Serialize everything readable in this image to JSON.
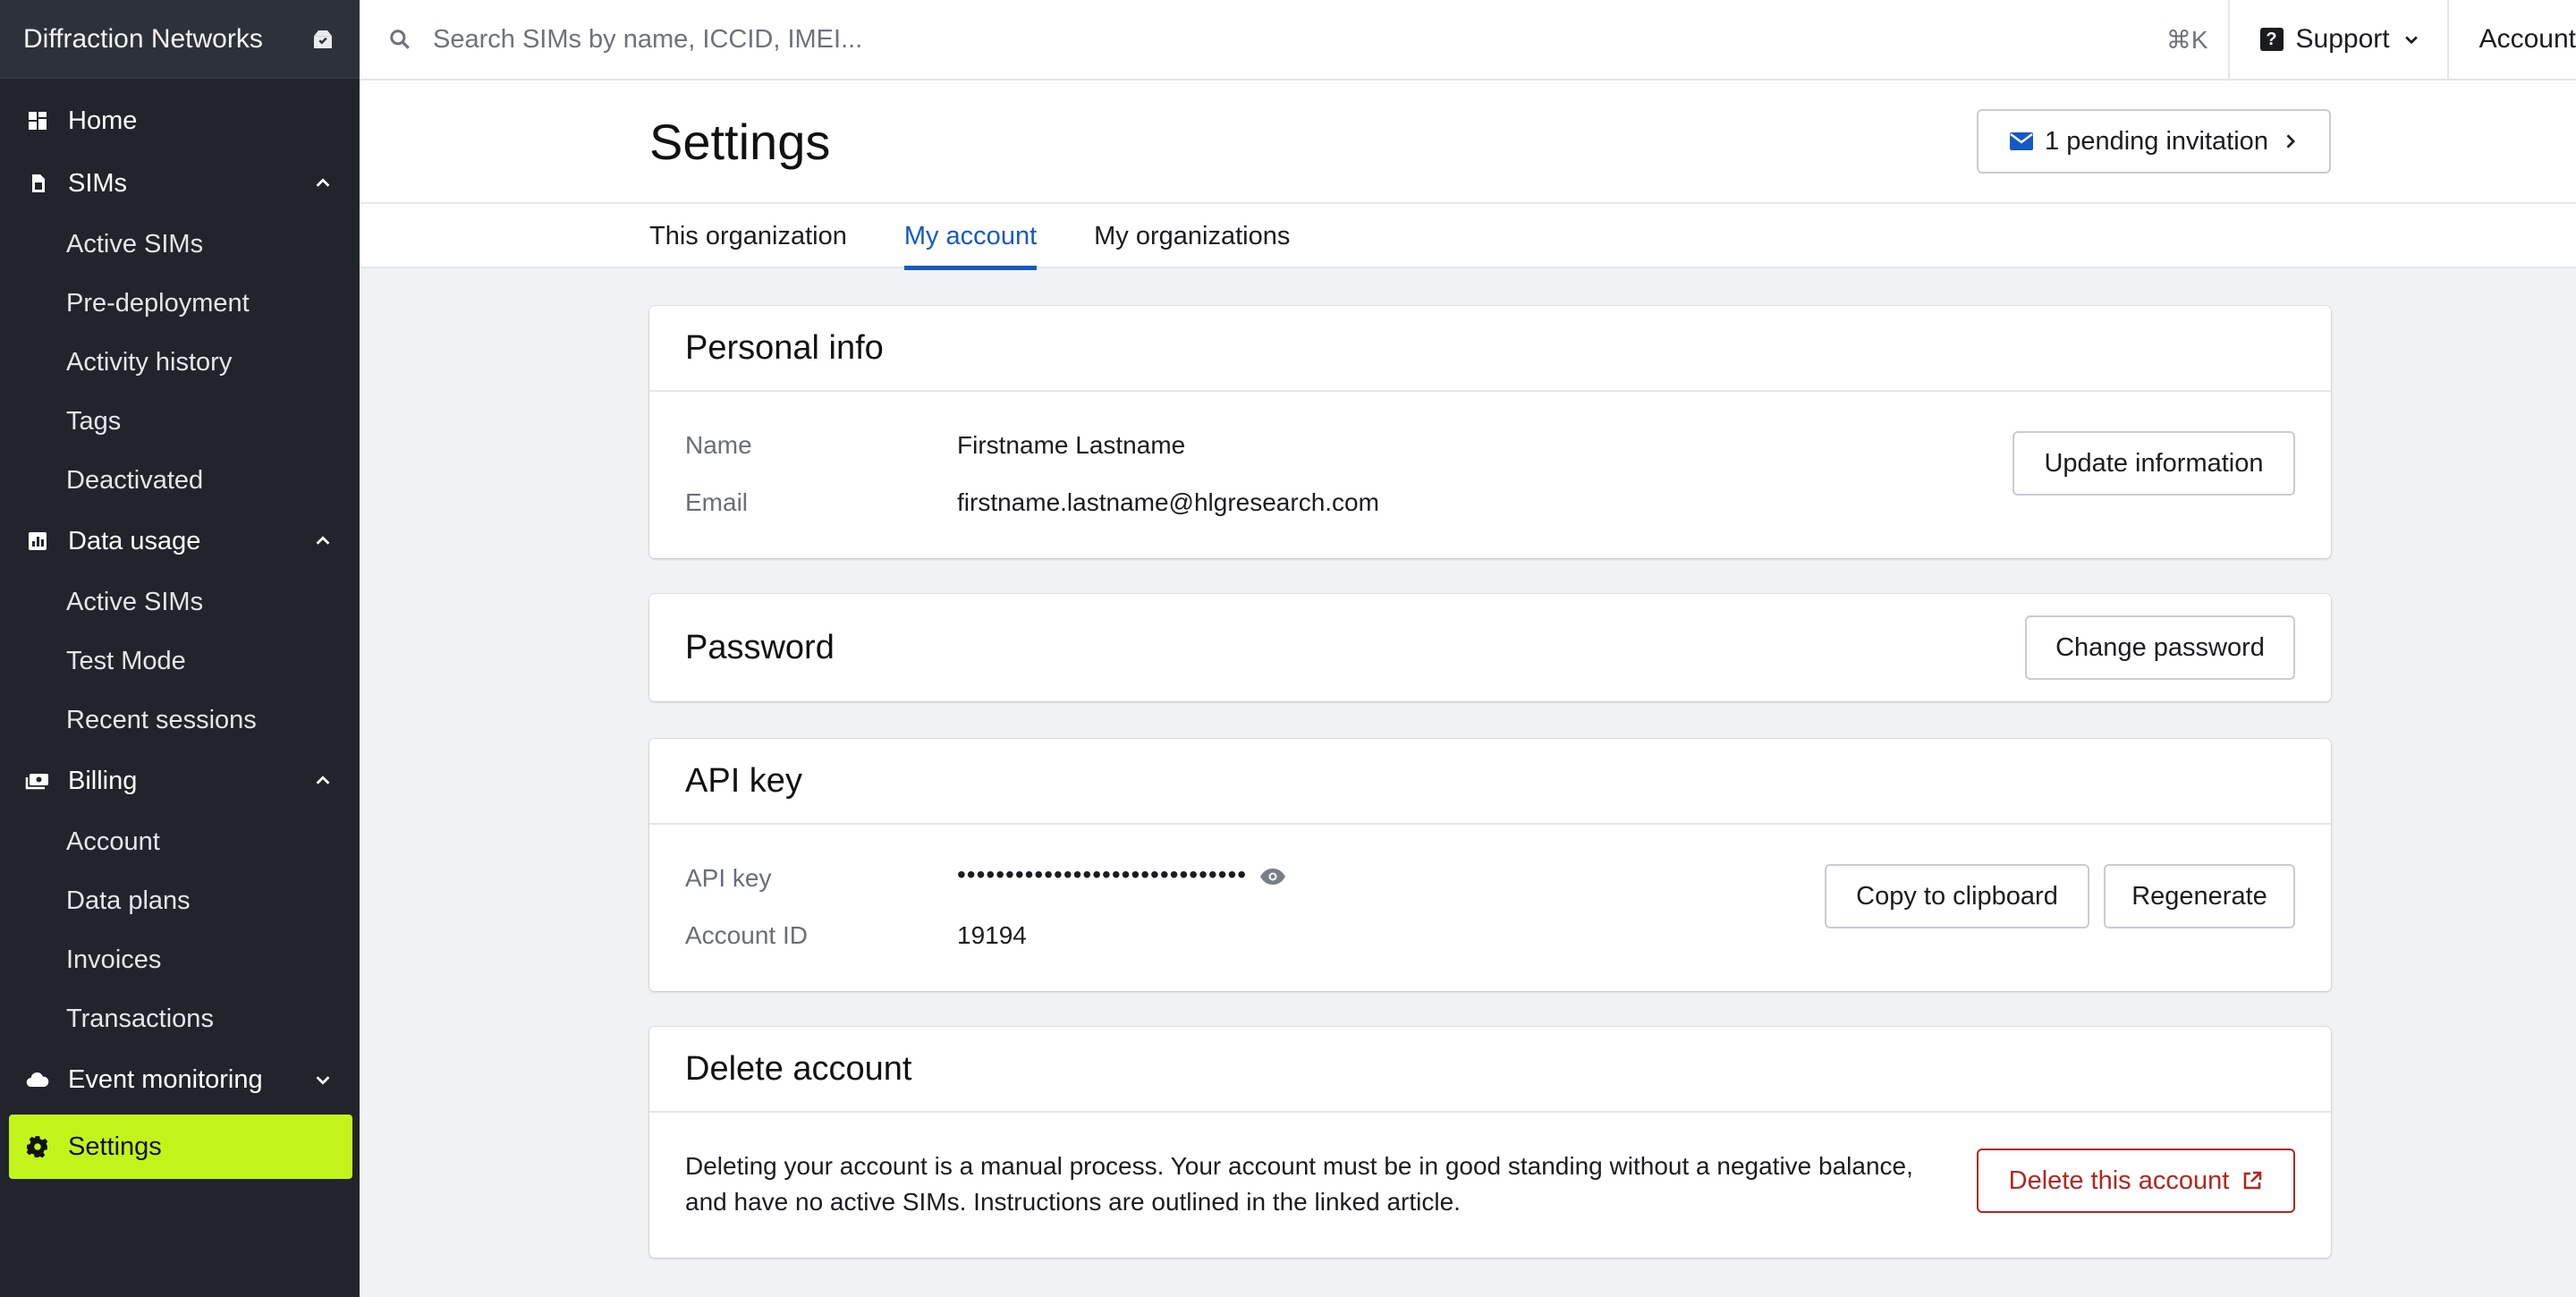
{
  "sidebar": {
    "org_name": "Diffraction Networks",
    "org_icon": "switch-org-icon",
    "items": [
      {
        "label": "Home",
        "icon": "grid-icon"
      },
      {
        "label": "SIMs",
        "icon": "sim-icon",
        "expanded": true,
        "children": [
          "Active SIMs",
          "Pre-deployment",
          "Activity history",
          "Tags",
          "Deactivated"
        ]
      },
      {
        "label": "Data usage",
        "icon": "chart-icon",
        "expanded": true,
        "children": [
          "Active SIMs",
          "Test Mode",
          "Recent sessions"
        ]
      },
      {
        "label": "Billing",
        "icon": "money-icon",
        "expanded": true,
        "children": [
          "Account",
          "Data plans",
          "Invoices",
          "Transactions"
        ]
      },
      {
        "label": "Event monitoring",
        "icon": "cloud-icon",
        "expanded": false
      },
      {
        "label": "Settings",
        "icon": "gear-icon",
        "active": true
      }
    ]
  },
  "topbar": {
    "search_placeholder": "Search SIMs by name, ICCID, IMEI...",
    "shortcut": "⌘K",
    "support_label": "Support",
    "account_label": "Account"
  },
  "page": {
    "title": "Settings",
    "invite_label": "1 pending invitation",
    "tabs": [
      "This organization",
      "My account",
      "My organizations"
    ],
    "active_tab": "My account"
  },
  "personal_info": {
    "title": "Personal info",
    "name_label": "Name",
    "name_value": "Firstname Lastname",
    "email_label": "Email",
    "email_value": "firstname.lastname@hlgresearch.com",
    "update_button": "Update information"
  },
  "password": {
    "title": "Password",
    "change_button": "Change password"
  },
  "api_key": {
    "title": "API key",
    "key_label": "API key",
    "key_value": "••••••••••••••••••••••••••••••",
    "account_id_label": "Account ID",
    "account_id_value": "19194",
    "copy_button": "Copy to clipboard",
    "regenerate_button": "Regenerate"
  },
  "delete_account": {
    "title": "Delete account",
    "description": "Deleting your account is a manual process. Your account must be in good standing without a negative balance, and have no active SIMs. Instructions are outlined in the linked article.",
    "delete_button": "Delete this account"
  },
  "colors": {
    "sidebar_bg": "#21242b",
    "active_nav": "#c3f41a",
    "accent_blue": "#1559c4",
    "danger": "#b3261e"
  }
}
